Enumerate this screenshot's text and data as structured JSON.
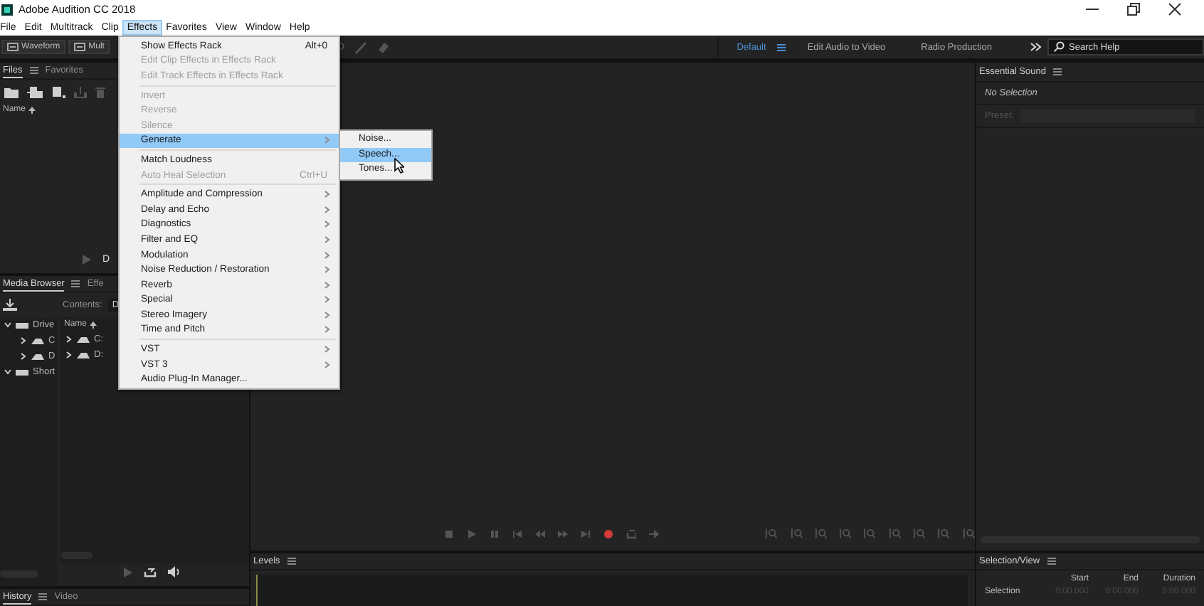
{
  "window": {
    "title": "Adobe Audition CC 2018"
  },
  "menu_bar": [
    {
      "label": "File",
      "selected": false
    },
    {
      "label": "Edit",
      "selected": false
    },
    {
      "label": "Multitrack",
      "selected": false
    },
    {
      "label": "Clip",
      "selected": false
    },
    {
      "label": "Effects",
      "selected": true
    },
    {
      "label": "Favorites",
      "selected": false
    },
    {
      "label": "View",
      "selected": false
    },
    {
      "label": "Window",
      "selected": false
    },
    {
      "label": "Help",
      "selected": false
    }
  ],
  "toolbar": {
    "view_buttons": [
      {
        "label": "Waveform",
        "selected": false
      },
      {
        "label": "Mult",
        "selected": false
      }
    ],
    "workspaces": [
      {
        "label": "Default",
        "selected": true
      },
      {
        "label": "Edit Audio to Video",
        "selected": false
      },
      {
        "label": "Radio Production",
        "selected": false
      }
    ],
    "search": {
      "placeholder": "Search Help"
    }
  },
  "files_panel": {
    "tabs": [
      {
        "label": "Files",
        "selected": true
      },
      {
        "label": "Favorites",
        "selected": false
      }
    ],
    "column": "Name",
    "footer_label": "D"
  },
  "media_browser": {
    "tabs": [
      {
        "label": "Media Browser",
        "selected": true
      },
      {
        "label": "Effe",
        "selected": false
      }
    ],
    "contents_label": "Contents:",
    "contents_value": "D",
    "column": "Name",
    "tree": [
      {
        "label": "Drive",
        "expanded": true,
        "children": [
          {
            "label": "C",
            "expanded": false
          },
          {
            "label": "D",
            "expanded": false
          }
        ]
      },
      {
        "label": "Short",
        "expanded": true
      }
    ],
    "files": [
      {
        "label": "C:",
        "expanded": false
      },
      {
        "label": "D:",
        "expanded": false
      }
    ]
  },
  "bottom_tabs": [
    {
      "label": "History",
      "selected": true
    },
    {
      "label": "Video",
      "selected": false
    }
  ],
  "levels_panel": {
    "title": "Levels"
  },
  "essential_sound": {
    "title": "Essential Sound",
    "status": "No Selection",
    "preset_label": "Preset:"
  },
  "selection_view": {
    "title": "Selection/View",
    "columns": [
      "Start",
      "End",
      "Duration"
    ],
    "rows": [
      {
        "label": "Selection",
        "values": [
          "0:00.000",
          "0:00.000",
          "0:00.000"
        ]
      }
    ]
  },
  "effects_menu": {
    "items": [
      {
        "kind": "item",
        "label": "Show Effects Rack",
        "shortcut": "Alt+0",
        "disabled": false,
        "submenu": false,
        "selected": false
      },
      {
        "kind": "item",
        "label": "Edit Clip Effects in Effects Rack",
        "disabled": true,
        "submenu": false,
        "selected": false
      },
      {
        "kind": "item",
        "label": "Edit Track Effects in Effects Rack",
        "disabled": true,
        "submenu": false,
        "selected": false
      },
      {
        "kind": "separator"
      },
      {
        "kind": "item",
        "label": "Invert",
        "disabled": true,
        "submenu": false,
        "selected": false
      },
      {
        "kind": "item",
        "label": "Reverse",
        "disabled": true,
        "submenu": false,
        "selected": false
      },
      {
        "kind": "item",
        "label": "Silence",
        "disabled": true,
        "submenu": false,
        "selected": false
      },
      {
        "kind": "item",
        "label": "Generate",
        "disabled": false,
        "submenu": true,
        "selected": true
      },
      {
        "kind": "separator"
      },
      {
        "kind": "item",
        "label": "Match Loudness",
        "disabled": false,
        "submenu": false,
        "selected": false
      },
      {
        "kind": "item",
        "label": "Auto Heal Selection",
        "shortcut": "Ctrl+U",
        "disabled": true,
        "submenu": false,
        "selected": false
      },
      {
        "kind": "separator"
      },
      {
        "kind": "item",
        "label": "Amplitude and Compression",
        "disabled": false,
        "submenu": true,
        "selected": false
      },
      {
        "kind": "item",
        "label": "Delay and Echo",
        "disabled": false,
        "submenu": true,
        "selected": false
      },
      {
        "kind": "item",
        "label": "Diagnostics",
        "disabled": false,
        "submenu": true,
        "selected": false
      },
      {
        "kind": "item",
        "label": "Filter and EQ",
        "disabled": false,
        "submenu": true,
        "selected": false
      },
      {
        "kind": "item",
        "label": "Modulation",
        "disabled": false,
        "submenu": true,
        "selected": false
      },
      {
        "kind": "item",
        "label": "Noise Reduction / Restoration",
        "disabled": false,
        "submenu": true,
        "selected": false
      },
      {
        "kind": "item",
        "label": "Reverb",
        "disabled": false,
        "submenu": true,
        "selected": false
      },
      {
        "kind": "item",
        "label": "Special",
        "disabled": false,
        "submenu": true,
        "selected": false
      },
      {
        "kind": "item",
        "label": "Stereo Imagery",
        "disabled": false,
        "submenu": true,
        "selected": false
      },
      {
        "kind": "item",
        "label": "Time and Pitch",
        "disabled": false,
        "submenu": true,
        "selected": false
      },
      {
        "kind": "separator"
      },
      {
        "kind": "item",
        "label": "VST",
        "disabled": false,
        "submenu": true,
        "selected": false
      },
      {
        "kind": "item",
        "label": "VST 3",
        "disabled": false,
        "submenu": true,
        "selected": false
      },
      {
        "kind": "item",
        "label": "Audio Plug-In Manager...",
        "disabled": false,
        "submenu": false,
        "selected": false
      }
    ]
  },
  "generate_submenu": {
    "items": [
      {
        "label": "Noise...",
        "selected": false
      },
      {
        "label": "Speech...",
        "selected": true
      },
      {
        "label": "Tones...",
        "selected": false
      }
    ]
  }
}
